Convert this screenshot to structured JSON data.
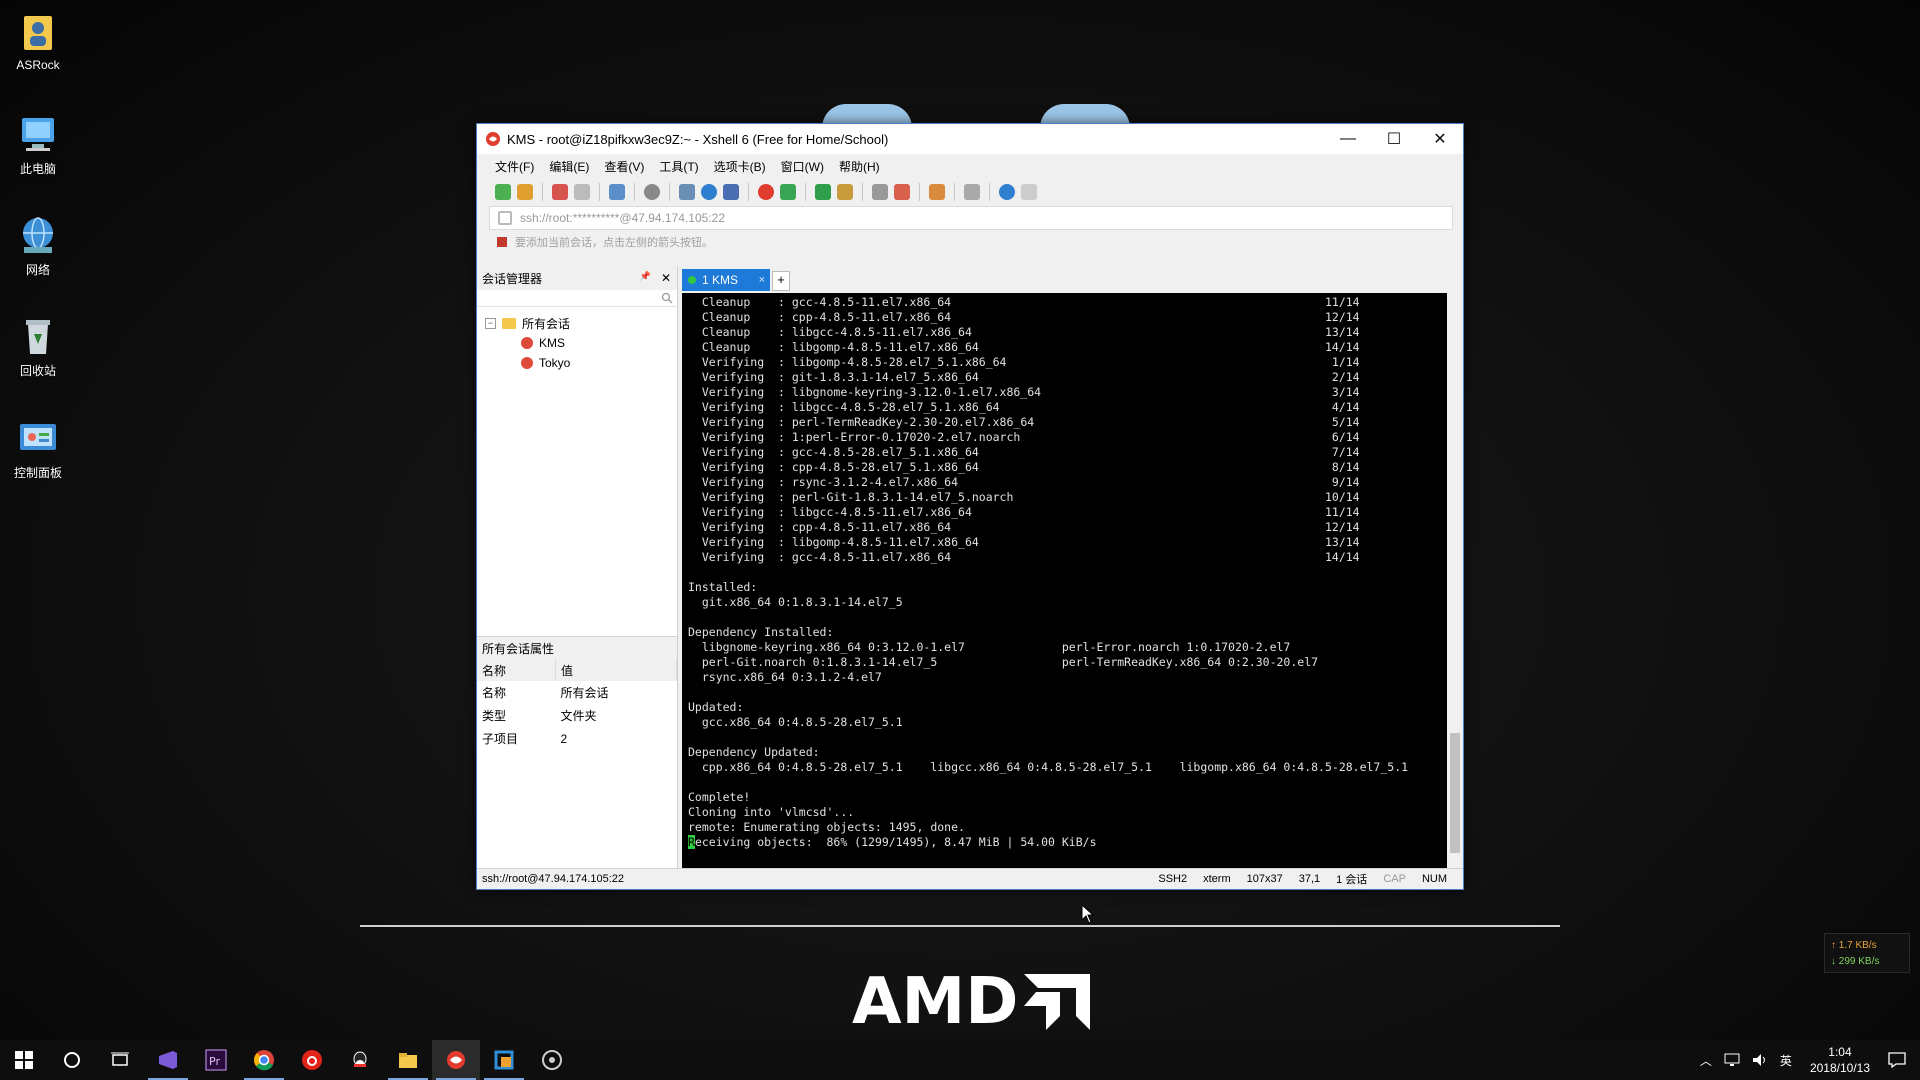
{
  "desktop": {
    "icons": [
      {
        "label": "ASRock"
      },
      {
        "label": "此电脑"
      },
      {
        "label": "网络"
      },
      {
        "label": "回收站"
      },
      {
        "label": "控制面板"
      }
    ]
  },
  "wallpaper": {
    "brand": "AMD"
  },
  "window": {
    "title": "KMS - root@iZ18pifkxw3ec9Z:~ - Xshell 6 (Free for Home/School)",
    "minimize": "—",
    "maximize": "☐",
    "close": "✕",
    "menu": [
      "文件(F)",
      "编辑(E)",
      "查看(V)",
      "工具(T)",
      "选项卡(B)",
      "窗口(W)",
      "帮助(H)"
    ],
    "address": "ssh://root:**********@47.94.174.105:22",
    "hint": "要添加当前会话，点击左侧的箭头按钮。"
  },
  "session_panel": {
    "title": "会话管理器",
    "pin": "📌",
    "close": "✕",
    "tree": {
      "root": "所有会话",
      "expander": "−",
      "children": [
        "KMS",
        "Tokyo"
      ]
    },
    "props_title": "所有会话属性",
    "props_headers": [
      "名称",
      "值"
    ],
    "props_rows": [
      {
        "k": "名称",
        "v": "所有会话"
      },
      {
        "k": "类型",
        "v": "文件夹"
      },
      {
        "k": "子项目",
        "v": "2"
      }
    ]
  },
  "tabs": [
    {
      "label": "1 KMS",
      "close": "×"
    }
  ],
  "tab_add": "+",
  "terminal": {
    "lines": [
      "  Cleanup    : gcc-4.8.5-11.el7.x86_64                                                      11/14",
      "  Cleanup    : cpp-4.8.5-11.el7.x86_64                                                      12/14",
      "  Cleanup    : libgcc-4.8.5-11.el7.x86_64                                                   13/14",
      "  Cleanup    : libgomp-4.8.5-11.el7.x86_64                                                  14/14",
      "  Verifying  : libgomp-4.8.5-28.el7_5.1.x86_64                                               1/14",
      "  Verifying  : git-1.8.3.1-14.el7_5.x86_64                                                   2/14",
      "  Verifying  : libgnome-keyring-3.12.0-1.el7.x86_64                                          3/14",
      "  Verifying  : libgcc-4.8.5-28.el7_5.1.x86_64                                                4/14",
      "  Verifying  : perl-TermReadKey-2.30-20.el7.x86_64                                           5/14",
      "  Verifying  : 1:perl-Error-0.17020-2.el7.noarch                                             6/14",
      "  Verifying  : gcc-4.8.5-28.el7_5.1.x86_64                                                   7/14",
      "  Verifying  : cpp-4.8.5-28.el7_5.1.x86_64                                                   8/14",
      "  Verifying  : rsync-3.1.2-4.el7.x86_64                                                      9/14",
      "  Verifying  : perl-Git-1.8.3.1-14.el7_5.noarch                                             10/14",
      "  Verifying  : libgcc-4.8.5-11.el7.x86_64                                                   11/14",
      "  Verifying  : cpp-4.8.5-11.el7.x86_64                                                      12/14",
      "  Verifying  : libgomp-4.8.5-11.el7.x86_64                                                  13/14",
      "  Verifying  : gcc-4.8.5-11.el7.x86_64                                                      14/14",
      "",
      "Installed:",
      "  git.x86_64 0:1.8.3.1-14.el7_5",
      "",
      "Dependency Installed:",
      "  libgnome-keyring.x86_64 0:3.12.0-1.el7              perl-Error.noarch 1:0.17020-2.el7",
      "  perl-Git.noarch 0:1.8.3.1-14.el7_5                  perl-TermReadKey.x86_64 0:2.30-20.el7",
      "  rsync.x86_64 0:3.1.2-4.el7",
      "",
      "Updated:",
      "  gcc.x86_64 0:4.8.5-28.el7_5.1",
      "",
      "Dependency Updated:",
      "  cpp.x86_64 0:4.8.5-28.el7_5.1    libgcc.x86_64 0:4.8.5-28.el7_5.1    libgomp.x86_64 0:4.8.5-28.el7_5.1",
      "",
      "Complete!",
      "Cloning into 'vlmcsd'...",
      "remote: Enumerating objects: 1495, done."
    ],
    "last_first_char": "R",
    "last_rest": "eceiving objects:  86% (1299/1495), 8.47 MiB | 54.00 KiB/s"
  },
  "status": {
    "address": "ssh://root@47.94.174.105:22",
    "protocol": "SSH2",
    "term": "xterm",
    "size": "107x37",
    "cursor": "37,1",
    "sessions": "1 会话",
    "cap": "CAP",
    "num": "NUM"
  },
  "netspeed": {
    "up": "↑ 1.7 KB/s",
    "down": "↓ 299 KB/s"
  },
  "tray": {
    "ime": "英",
    "time": "1:04",
    "date": "2018/10/13"
  },
  "colors": {
    "accent": "#1e7ad8",
    "cursor": "#2ecc40"
  }
}
